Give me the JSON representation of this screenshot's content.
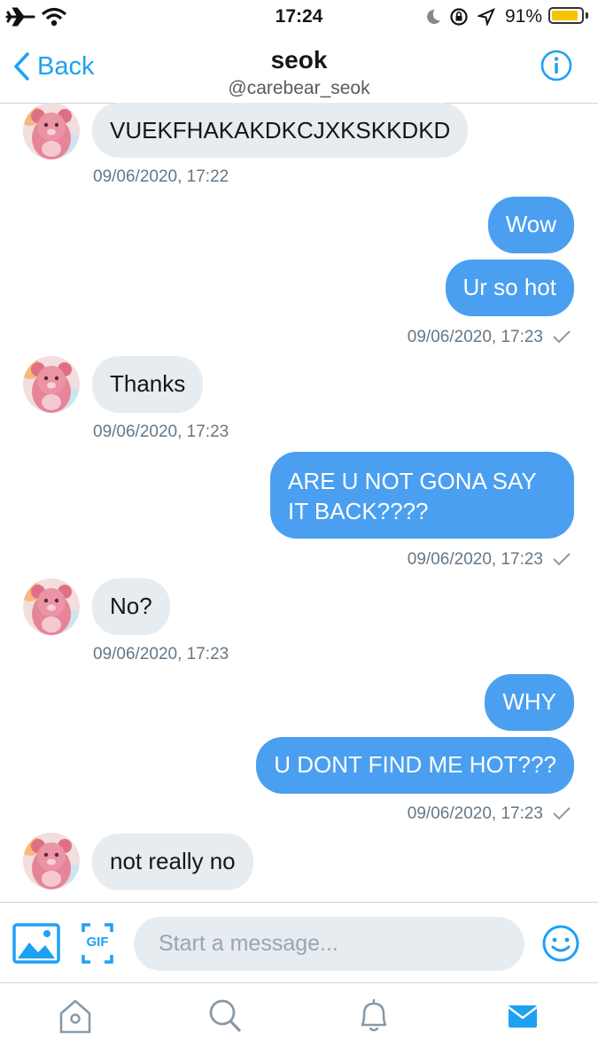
{
  "status_bar": {
    "time": "17:24",
    "battery_text": "91%",
    "battery_level": 0.91,
    "battery_color": "#f5c400"
  },
  "header": {
    "back_label": "Back",
    "title": "seok",
    "subtitle": "@carebear_seok"
  },
  "colors": {
    "accent": "#1da1f2",
    "sent_bubble": "#4a9ff0",
    "received_bubble": "#e6ecf0"
  },
  "messages": [
    {
      "direction": "received",
      "text": "VUEKFHAKAKDKCJXKSKKDKD"
    },
    {
      "direction": "received_timestamp",
      "text": "09/06/2020, 17:22"
    },
    {
      "direction": "sent",
      "text": "Wow"
    },
    {
      "direction": "sent",
      "text": "Ur so hot"
    },
    {
      "direction": "sent_timestamp",
      "text": "09/06/2020, 17:23"
    },
    {
      "direction": "received",
      "text": "Thanks"
    },
    {
      "direction": "received_timestamp",
      "text": "09/06/2020, 17:23"
    },
    {
      "direction": "sent",
      "text": "ARE U NOT GONA SAY IT BACK????"
    },
    {
      "direction": "sent_timestamp",
      "text": "09/06/2020, 17:23"
    },
    {
      "direction": "received",
      "text": "No?"
    },
    {
      "direction": "received_timestamp",
      "text": "09/06/2020, 17:23"
    },
    {
      "direction": "sent",
      "text": "WHY"
    },
    {
      "direction": "sent",
      "text": "U DONT FIND ME HOT???"
    },
    {
      "direction": "sent_timestamp",
      "text": "09/06/2020, 17:23"
    },
    {
      "direction": "received",
      "text": "not really no"
    }
  ],
  "composer": {
    "placeholder": "Start a message...",
    "gif_label": "GIF"
  },
  "tab_bar": {
    "items": [
      "home-icon",
      "search-icon",
      "bell-icon",
      "mail-icon"
    ],
    "active": "mail-icon"
  }
}
